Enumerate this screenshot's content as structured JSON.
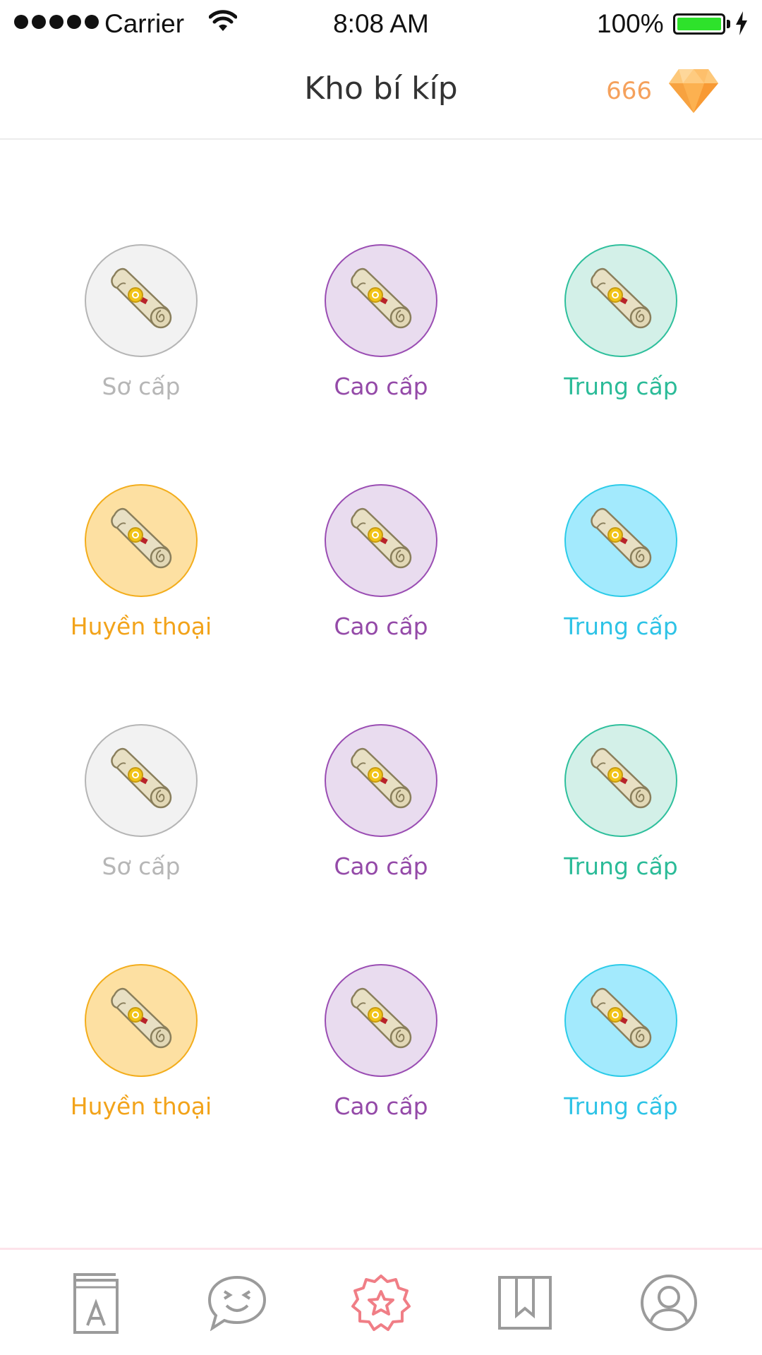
{
  "status_bar": {
    "carrier": "Carrier",
    "time": "8:08 AM",
    "battery": "100%",
    "battery_level": 1.0,
    "battery_color": "#2ee22b"
  },
  "header": {
    "title": "Kho bí kíp",
    "gem_count": "666",
    "gem_icon": "diamond-icon",
    "gem_color": "#f5a15c"
  },
  "scrolls": [
    {
      "label": "Sơ cấp",
      "tier": "so"
    },
    {
      "label": "Cao cấp",
      "tier": "cao"
    },
    {
      "label": "Trung cấp",
      "tier": "trung-green"
    },
    {
      "label": "Huyền thoại",
      "tier": "huyen"
    },
    {
      "label": "Cao cấp",
      "tier": "cao"
    },
    {
      "label": "Trung cấp",
      "tier": "trung-blue"
    },
    {
      "label": "Sơ cấp",
      "tier": "so"
    },
    {
      "label": "Cao cấp",
      "tier": "cao"
    },
    {
      "label": "Trung cấp",
      "tier": "trung-green"
    },
    {
      "label": "Huyền thoại",
      "tier": "huyen"
    },
    {
      "label": "Cao cấp",
      "tier": "cao"
    },
    {
      "label": "Trung cấp",
      "tier": "trung-blue"
    }
  ],
  "tabbar": {
    "tabs": [
      {
        "icon": "dictionary-book-icon",
        "active": false
      },
      {
        "icon": "chat-emoji-icon",
        "active": false
      },
      {
        "icon": "star-badge-icon",
        "active": true
      },
      {
        "icon": "bookmark-icon",
        "active": false
      },
      {
        "icon": "profile-icon",
        "active": false
      }
    ],
    "active_color": "#f07e86",
    "inactive_color": "#9b9b9b"
  }
}
